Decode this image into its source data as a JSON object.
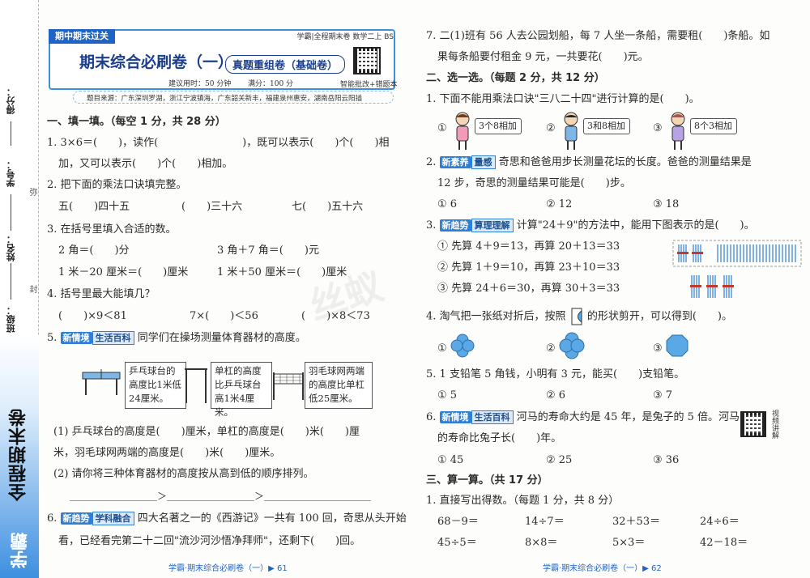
{
  "binding": {
    "fields": [
      "得分：",
      "学号：",
      "姓名：",
      "班级："
    ],
    "seal_chars": [
      "弥",
      "封",
      "线"
    ],
    "brand_main": "全程期末卷",
    "brand_logo": "学霸"
  },
  "left_page": {
    "ribbon": "期中期末过关",
    "series": "学霸|全程期末卷 数学二上 BS",
    "title": "期末综合必刷卷（一）",
    "subtitle": "真题重组卷（基础卷）",
    "time_label": "建议用时：50 分钟",
    "score_label": "满分：100 分",
    "qr_note": "智能批改+错题本",
    "sources": "题目来源：广东深圳罗湖，浙江宁波镇海，广东韶关新丰，福建泉州惠安，湖南岳阳云阳插",
    "section1": "一、填一填。（每空 1 分，共 28 分）",
    "q1_line1": "1. 3×6＝(　　)，读作(　　　　　　　　)，既可以表示(　　)个(　　)相",
    "q1_line2": "加，又可以表示(　　)个(　　)相加。",
    "q2": "2. 把下面的乘法口诀填完整。",
    "q2_items": [
      "五(　　)四十五",
      "(　　)三十六",
      "七(　　)五十六"
    ],
    "q3": "3. 在括号里填入合适的数。",
    "q3_row1": [
      "2 角＝(　　)分",
      "3 角＋7 角＝(　　)元"
    ],
    "q3_row2": [
      "1 米－20 厘米＝(　　)厘米",
      "1 米＋50 厘米＝(　　)厘米"
    ],
    "q4": "4. 括号里最大能填几？",
    "q4_items": [
      "(　　)×9＜81",
      "7×(　　)＜56",
      "(　　)×8＜73"
    ],
    "q5_num": "5.",
    "q5_tag1": "新情境",
    "q5_tag2": "生活百科",
    "q5_text": "同学们在操场测量体育器材的高度。",
    "q5_box1": "乒乓球台的高度比1米低24厘米。",
    "q5_box2": "单杠的高度比乒乓球台高1米4厘米。",
    "q5_box3": "羽毛球网两端的高度比单杠低25厘米。",
    "q5_sub1_line1": "(1) 乒乓球台的高度是(　　)厘米，单杠的高度是(　　)米(　　)厘",
    "q5_sub1_line2": "米，羽毛球网两端的高度是(　　)米(　　)厘米。",
    "q5_sub2": "(2) 请你将三种体育器材的高度按从高到低的顺序排列。",
    "q5_order": "＿＿＿＿＿＿＿＿＿＞＿＿＿＿＿＿＿＿＿＞＿＿＿＿＿＿＿＿＿＿＿",
    "q6_num": "6.",
    "q6_tag1": "新趋势",
    "q6_tag2": "学科融合",
    "q6_line1": "四大名著之一的《西游记》一共有 100 回，奇思从头开始",
    "q6_line2": "看，已经看完第二十二回\"流沙河沙悟净拜师\"，还剩下(　　)回。",
    "footer": "学霸·期末综合必刷卷（一）▶ 61"
  },
  "right_page": {
    "q7_line1": "7. 二(1)班有 56 人去公园划船，每 7 人坐一条船，需要租(　　)条船。如",
    "q7_line2": "果每条船要付租金 9 元，一共要花(　　)元。",
    "section2": "二、选一选。（每题 2 分，共 12 分）",
    "q1": "1. 下面不能用乘法口诀\"三八二十四\"进行计算的是(　　)。",
    "q1_options": [
      "①",
      "②",
      "③"
    ],
    "q1_bubbles": [
      "3个8相加",
      "3和8相加",
      "8个3相加"
    ],
    "q2_num": "2.",
    "q2_tag1": "新素养",
    "q2_tag2": "量感",
    "q2_line1": "奇思和爸爸用步长测量花坛的长度。爸爸的测量结果是",
    "q2_line2": "12 步，奇思的测量结果可能是(　　)步。",
    "q2_options": [
      "① 6",
      "② 12",
      "③ 18"
    ],
    "q3_num": "3.",
    "q3_tag1": "新趋势",
    "q3_tag2": "算理理解",
    "q3_text": "计算\"24＋9\"的方法中，能用下图表示的是(　　)。",
    "q3_options": [
      "① 先算 4＋9＝13，再算 20＋13＝33",
      "② 先算 1＋9＝10，再算 23＋10＝33",
      "③ 先算 24＋6＝30，再算 30＋3＝33"
    ],
    "q4_text_a": "4. 淘气把一张纸对折后，按照",
    "q4_text_b": "的形状剪开，可以得到(　　)。",
    "q4_options": [
      "①",
      "②",
      "③"
    ],
    "q5": "5. 1 支铅笔 5 角钱，小明有 3 元，能买(　　)支铅笔。",
    "q5_options": [
      "① 5",
      "② 6",
      "③ 7"
    ],
    "q6_num": "6.",
    "q6_tag1": "新情境",
    "q6_tag2": "生活百科",
    "q6_line1": "河马的寿命大约是 45 年，是兔子的 5 倍。河马",
    "q6_line2": "的寿命比兔子长(　　)年。",
    "q6_options": [
      "① 45",
      "② 25",
      "③ 36"
    ],
    "q6_qr_note": "视频讲解",
    "section3": "三、算一算。（共 17 分）",
    "s3_q1": "1. 直接写出得数。（每题 1 分，共 8 分）",
    "calc_row1": [
      "68－9＝",
      "14÷7＝",
      "32＋53＝",
      "24÷6＝"
    ],
    "calc_row2": [
      "45÷5＝",
      "8×8＝",
      "5×3＝",
      "42－18＝"
    ],
    "footer": "学霸·期末综合必刷卷（一）▶ 62"
  },
  "watermark": "丝蚁"
}
